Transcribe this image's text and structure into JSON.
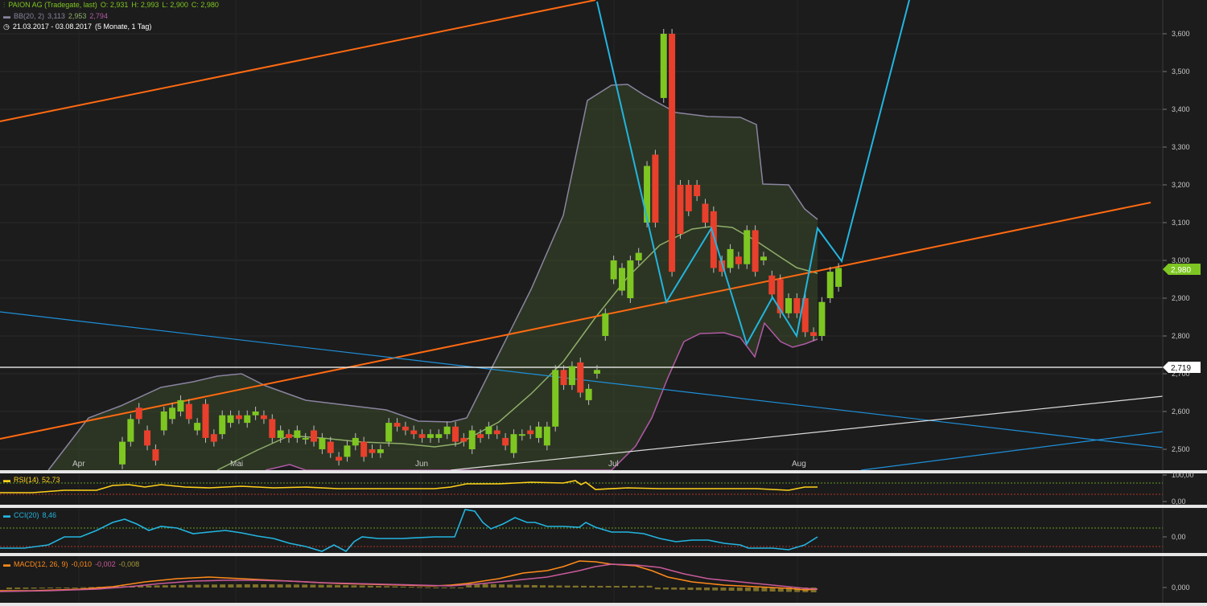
{
  "header": {
    "instrument": "PAION AG (Tradegate, last)",
    "open": "O: 2,931",
    "high": "H: 2,993",
    "low": "L: 2,900",
    "close": "C: 2,980",
    "bb_label": "BB(20, 2)",
    "bb_upper": "3,113",
    "bb_mid": "2,953",
    "bb_lower": "2,794",
    "range": "21.03.2017 - 03.08.2017",
    "range_detail": "(5 Monate, 1 Tag)"
  },
  "price_axis": {
    "ticks": [
      "3,600",
      "3,500",
      "3,400",
      "3,300",
      "3,200",
      "3,100",
      "3,000",
      "2,900",
      "2,800",
      "2,700",
      "2,600",
      "2,500"
    ],
    "last_price_badge": "2,980",
    "crosshair_badge": "2,719"
  },
  "time_axis": {
    "labels": [
      "Apr",
      "Mai",
      "Jun",
      "Jul",
      "Aug"
    ]
  },
  "indicators": {
    "rsi": {
      "label": "RSI(14)",
      "value": "52,73",
      "ticks": [
        "100,00",
        "0,00"
      ]
    },
    "cci": {
      "label": "CCI(20)",
      "value": "8,46",
      "ticks": [
        "0,00"
      ]
    },
    "macd": {
      "label": "MACD(12, 26, 9)",
      "v1": "-0,010",
      "v2": "-0,002",
      "v3": "-0,008",
      "ticks": [
        "0,000"
      ]
    }
  },
  "colors": {
    "up": "#7ec622",
    "down": "#e8402c",
    "trend": "#ff6a12",
    "zigzag": "#22b5e0",
    "bb_upper": "#8a84a0",
    "bb_mid": "#8fae6a",
    "bb_lower": "#b05aa6"
  },
  "chart_data": {
    "type": "candlestick",
    "title": "PAION AG (Tradegate, last)",
    "x_range": [
      "2017-03-21",
      "2017-08-03"
    ],
    "ylim": [
      2.45,
      3.7
    ],
    "candles": [
      {
        "o": 2.46,
        "c": 2.52,
        "d": "up"
      },
      {
        "o": 2.52,
        "c": 2.58,
        "d": "up"
      },
      {
        "o": 2.61,
        "c": 2.58,
        "d": "down"
      },
      {
        "o": 2.55,
        "c": 2.51,
        "d": "down"
      },
      {
        "o": 2.5,
        "c": 2.47,
        "d": "down"
      },
      {
        "o": 2.55,
        "c": 2.6,
        "d": "up"
      },
      {
        "o": 2.58,
        "c": 2.61,
        "d": "up"
      },
      {
        "o": 2.6,
        "c": 2.63,
        "d": "up"
      },
      {
        "o": 2.62,
        "c": 2.58,
        "d": "down"
      },
      {
        "o": 2.55,
        "c": 2.57,
        "d": "up"
      },
      {
        "o": 2.62,
        "c": 2.53,
        "d": "down"
      },
      {
        "o": 2.54,
        "c": 2.52,
        "d": "down"
      },
      {
        "o": 2.54,
        "c": 2.59,
        "d": "up"
      },
      {
        "o": 2.57,
        "c": 2.59,
        "d": "up"
      },
      {
        "o": 2.59,
        "c": 2.58,
        "d": "down"
      },
      {
        "o": 2.57,
        "c": 2.59,
        "d": "up"
      },
      {
        "o": 2.59,
        "c": 2.6,
        "d": "up"
      },
      {
        "o": 2.59,
        "c": 2.58,
        "d": "down"
      },
      {
        "o": 2.58,
        "c": 2.53,
        "d": "down"
      },
      {
        "o": 2.53,
        "c": 2.55,
        "d": "up"
      },
      {
        "o": 2.54,
        "c": 2.53,
        "d": "down"
      },
      {
        "o": 2.53,
        "c": 2.55,
        "d": "up"
      },
      {
        "o": 2.53,
        "c": 2.53,
        "d": "up"
      },
      {
        "o": 2.55,
        "c": 2.52,
        "d": "down"
      },
      {
        "o": 2.5,
        "c": 2.53,
        "d": "up"
      },
      {
        "o": 2.52,
        "c": 2.49,
        "d": "down"
      },
      {
        "o": 2.48,
        "c": 2.47,
        "d": "down"
      },
      {
        "o": 2.48,
        "c": 2.51,
        "d": "up"
      },
      {
        "o": 2.51,
        "c": 2.53,
        "d": "up"
      },
      {
        "o": 2.52,
        "c": 2.48,
        "d": "down"
      },
      {
        "o": 2.5,
        "c": 2.49,
        "d": "down"
      },
      {
        "o": 2.49,
        "c": 2.5,
        "d": "up"
      },
      {
        "o": 2.52,
        "c": 2.57,
        "d": "up"
      },
      {
        "o": 2.57,
        "c": 2.56,
        "d": "down"
      },
      {
        "o": 2.56,
        "c": 2.55,
        "d": "down"
      },
      {
        "o": 2.55,
        "c": 2.54,
        "d": "down"
      },
      {
        "o": 2.54,
        "c": 2.53,
        "d": "down"
      },
      {
        "o": 2.53,
        "c": 2.54,
        "d": "up"
      },
      {
        "o": 2.53,
        "c": 2.54,
        "d": "up"
      },
      {
        "o": 2.54,
        "c": 2.56,
        "d": "up"
      },
      {
        "o": 2.56,
        "c": 2.52,
        "d": "down"
      },
      {
        "o": 2.53,
        "c": 2.52,
        "d": "down"
      },
      {
        "o": 2.5,
        "c": 2.55,
        "d": "up"
      },
      {
        "o": 2.54,
        "c": 2.53,
        "d": "down"
      },
      {
        "o": 2.54,
        "c": 2.56,
        "d": "up"
      },
      {
        "o": 2.55,
        "c": 2.54,
        "d": "down"
      },
      {
        "o": 2.53,
        "c": 2.51,
        "d": "down"
      },
      {
        "o": 2.49,
        "c": 2.54,
        "d": "up"
      },
      {
        "o": 2.54,
        "c": 2.54,
        "d": "up"
      },
      {
        "o": 2.55,
        "c": 2.54,
        "d": "down"
      },
      {
        "o": 2.53,
        "c": 2.56,
        "d": "up"
      },
      {
        "o": 2.51,
        "c": 2.56,
        "d": "up"
      },
      {
        "o": 2.56,
        "c": 2.71,
        "d": "up"
      },
      {
        "o": 2.71,
        "c": 2.67,
        "d": "down"
      },
      {
        "o": 2.67,
        "c": 2.72,
        "d": "up"
      },
      {
        "o": 2.73,
        "c": 2.65,
        "d": "down"
      },
      {
        "o": 2.63,
        "c": 2.66,
        "d": "up"
      },
      {
        "o": 2.7,
        "c": 2.71,
        "d": "up"
      },
      {
        "o": 2.8,
        "c": 2.86,
        "d": "up"
      },
      {
        "o": 2.95,
        "c": 3.0,
        "d": "up"
      },
      {
        "o": 2.92,
        "c": 2.98,
        "d": "up"
      },
      {
        "o": 2.9,
        "c": 3.0,
        "d": "up"
      },
      {
        "o": 3.0,
        "c": 3.02,
        "d": "up"
      },
      {
        "o": 3.1,
        "c": 3.25,
        "d": "up"
      },
      {
        "o": 3.28,
        "c": 3.1,
        "d": "down"
      },
      {
        "o": 3.43,
        "c": 3.6,
        "d": "up"
      },
      {
        "o": 3.6,
        "c": 2.97,
        "d": "down"
      },
      {
        "o": 3.2,
        "c": 3.07,
        "d": "down"
      },
      {
        "o": 3.2,
        "c": 3.13,
        "d": "down"
      },
      {
        "o": 3.2,
        "c": 3.17,
        "d": "down"
      },
      {
        "o": 3.15,
        "c": 3.1,
        "d": "down"
      },
      {
        "o": 3.13,
        "c": 2.98,
        "d": "down"
      },
      {
        "o": 3.0,
        "c": 2.97,
        "d": "down"
      },
      {
        "o": 2.98,
        "c": 3.03,
        "d": "up"
      },
      {
        "o": 3.01,
        "c": 2.99,
        "d": "down"
      },
      {
        "o": 2.99,
        "c": 3.08,
        "d": "up"
      },
      {
        "o": 3.08,
        "c": 2.97,
        "d": "down"
      },
      {
        "o": 3.0,
        "c": 3.01,
        "d": "up"
      },
      {
        "o": 2.96,
        "c": 2.91,
        "d": "down"
      },
      {
        "o": 2.95,
        "c": 2.86,
        "d": "down"
      },
      {
        "o": 2.86,
        "c": 2.9,
        "d": "up"
      },
      {
        "o": 2.9,
        "c": 2.86,
        "d": "down"
      },
      {
        "o": 2.9,
        "c": 2.81,
        "d": "down"
      },
      {
        "o": 2.81,
        "c": 2.8,
        "d": "down"
      },
      {
        "o": 2.8,
        "c": 2.89,
        "d": "up"
      },
      {
        "o": 2.9,
        "c": 2.97,
        "d": "up"
      },
      {
        "o": 2.93,
        "c": 2.98,
        "d": "up"
      }
    ]
  }
}
